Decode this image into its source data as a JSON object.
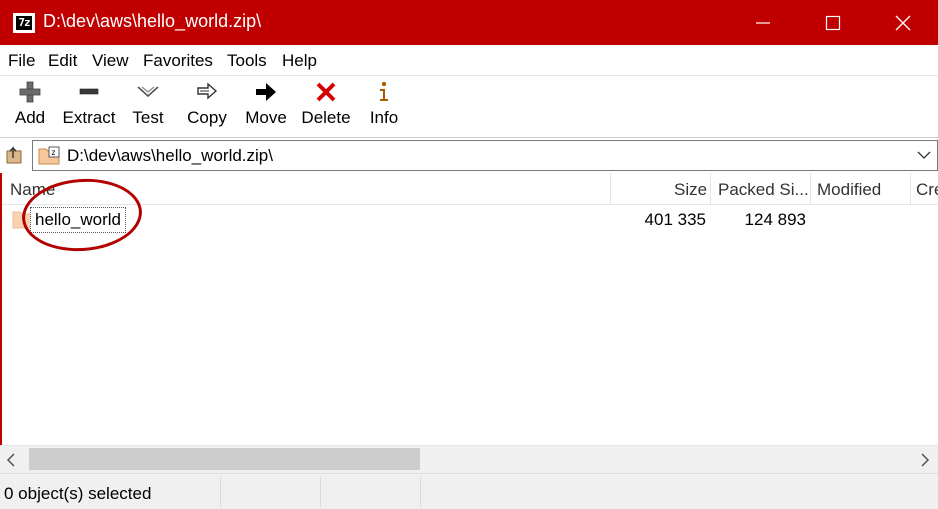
{
  "window": {
    "title": "D:\\dev\\aws\\hello_world.zip\\",
    "app_icon_text": "7z",
    "accent_color": "#c00000"
  },
  "menu": {
    "items": [
      {
        "label": "File"
      },
      {
        "label": "Edit"
      },
      {
        "label": "View"
      },
      {
        "label": "Favorites"
      },
      {
        "label": "Tools"
      },
      {
        "label": "Help"
      }
    ]
  },
  "toolbar": {
    "items": [
      {
        "label": "Add",
        "icon": "plus-icon"
      },
      {
        "label": "Extract",
        "icon": "minus-icon"
      },
      {
        "label": "Test",
        "icon": "check-chevron-icon"
      },
      {
        "label": "Copy",
        "icon": "copy-arrows-icon"
      },
      {
        "label": "Move",
        "icon": "arrow-right-icon"
      },
      {
        "label": "Delete",
        "icon": "x-icon"
      },
      {
        "label": "Info",
        "icon": "info-icon"
      }
    ]
  },
  "address": {
    "path": "D:\\dev\\aws\\hello_world.zip\\"
  },
  "list": {
    "columns": [
      "Name",
      "Size",
      "Packed Si...",
      "Modified",
      "Cre"
    ],
    "rows": [
      {
        "name": "hello_world",
        "size": "401 335",
        "packed": "124 893",
        "modified": ""
      }
    ]
  },
  "status": {
    "text": "0 object(s) selected"
  }
}
